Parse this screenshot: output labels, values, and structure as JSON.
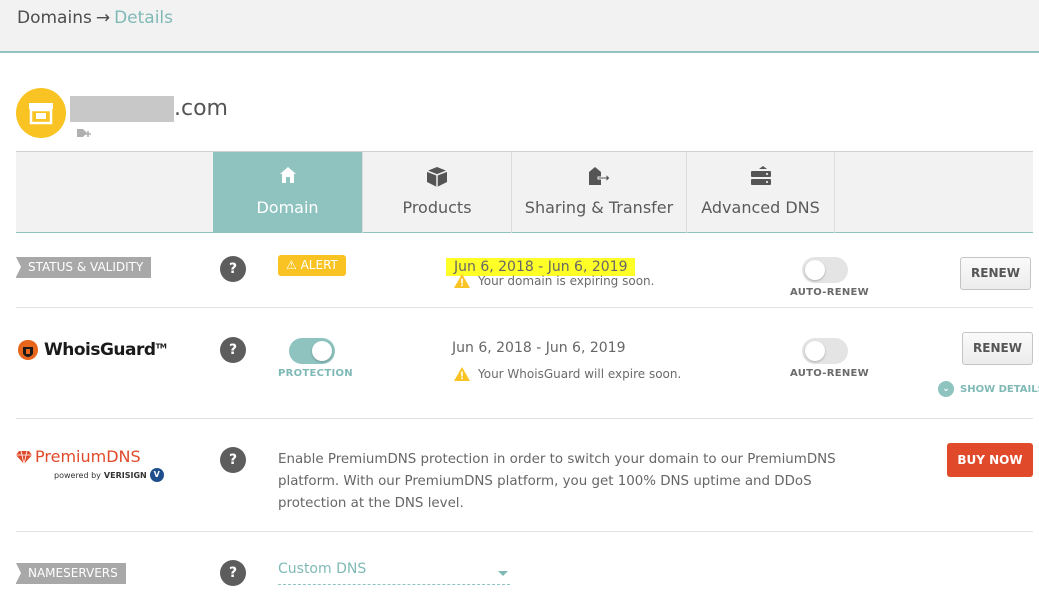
{
  "breadcrumb": {
    "parent": "Domains",
    "arrow": "→",
    "current": "Details"
  },
  "domain": {
    "tld": ".com",
    "masked": true,
    "avatar_icon": "shop-icon",
    "tag_icon": "tag-add-icon"
  },
  "tabs": [
    {
      "label": "Domain",
      "icon": "home-icon",
      "active": true
    },
    {
      "label": "Products",
      "icon": "box-icon",
      "active": false
    },
    {
      "label": "Sharing & Transfer",
      "icon": "transfer-icon",
      "active": false
    },
    {
      "label": "Advanced DNS",
      "icon": "server-icon",
      "active": false
    }
  ],
  "status": {
    "label": "STATUS & VALIDITY",
    "help": "?",
    "alert": "ALERT",
    "dates": "Jun 6, 2018 - Jun 6, 2019",
    "warning": "Your domain is expiring soon.",
    "auto_renew_label": "AUTO-RENEW",
    "auto_renew_on": false,
    "renew": "RENEW"
  },
  "whoisguard": {
    "logo_text": "WhoisGuard",
    "logo_tm": "TM",
    "help": "?",
    "protection_label": "PROTECTION",
    "protection_on": true,
    "dates": "Jun 6, 2018 - Jun 6, 2019",
    "warning": "Your WhoisGuard will expire soon.",
    "auto_renew_label": "AUTO-RENEW",
    "auto_renew_on": false,
    "renew": "RENEW",
    "show_details": "SHOW DETAILS"
  },
  "premiumdns": {
    "logo_text": "PremiumDNS",
    "powered_by": "powered by",
    "powered_brand": "VERISIGN",
    "help": "?",
    "description": "Enable PremiumDNS protection in order to switch your domain to our PremiumDNS platform. With our PremiumDNS platform, you get 100% DNS uptime and DDoS protection at the DNS level.",
    "buy": "BUY NOW"
  },
  "nameservers": {
    "label": "NAMESERVERS",
    "help": "?",
    "selected": "Custom DNS"
  },
  "colors": {
    "teal": "#8ec3c0",
    "yellow": "#f9c423",
    "buy": "#e04a2a",
    "label_gray": "#a8a8a8"
  }
}
